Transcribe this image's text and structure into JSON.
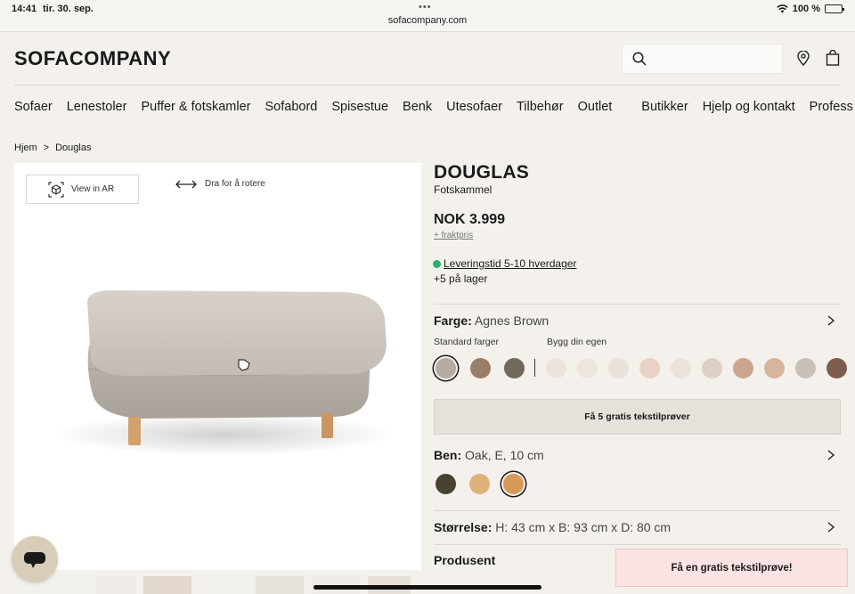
{
  "status_bar": {
    "time": "14:41",
    "date": "tir. 30. sep.",
    "url": "sofacompany.com",
    "battery": "100 %"
  },
  "header": {
    "logo": "SOFACOMPANY",
    "icons": [
      "search-icon",
      "location-pin-icon",
      "shopping-bag-icon"
    ]
  },
  "nav": {
    "left": [
      "Sofaer",
      "Lenestoler",
      "Puffer & fotskamler",
      "Sofabord",
      "Spisestue",
      "Benk",
      "Utesofaer",
      "Tilbehør",
      "Outlet"
    ],
    "right": [
      "Butikker",
      "Hjelp og kontakt",
      "Profess"
    ]
  },
  "breadcrumb": {
    "home": "Hjem",
    "separator": ">",
    "current": "Douglas"
  },
  "viewer": {
    "ar_label": "View in AR",
    "rotate_hint": "Dra for å rotere"
  },
  "product": {
    "name": "DOUGLAS",
    "type": "Fotskammel",
    "price": "NOK 3.999",
    "freight": "+ fraktpris",
    "delivery": "Leveringstid 5-10 hverdager",
    "stock": "+5 på lager"
  },
  "color": {
    "label": "Farge:",
    "value": "Agnes Brown",
    "standard_label": "Standard farger",
    "custom_label": "Bygg din egen",
    "standard_swatches": [
      "#b6aaa0",
      "#9a7e6a",
      "#726a58"
    ],
    "custom_swatches": [
      "#ede4dc",
      "#ece6df",
      "#e9e2db",
      "#e8d2c4",
      "#e9e3db",
      "#dccfc3",
      "#cba590",
      "#d6b59c",
      "#c8c1ba",
      "#7d5e4e"
    ],
    "selected_index": 0
  },
  "samples_button": "Få 5 gratis tekstilprøver",
  "legs": {
    "label": "Ben:",
    "value": "Oak, E, 10 cm",
    "swatches": [
      "#4a4230",
      "#dfb27c",
      "#d89a58"
    ],
    "selected_index": 2
  },
  "size": {
    "label": "Størrelse:",
    "value": "H: 43 cm x B: 93 cm x D: 80 cm"
  },
  "producer": {
    "label": "Produsent"
  },
  "toast": "Få en gratis tekstilprøve!"
}
